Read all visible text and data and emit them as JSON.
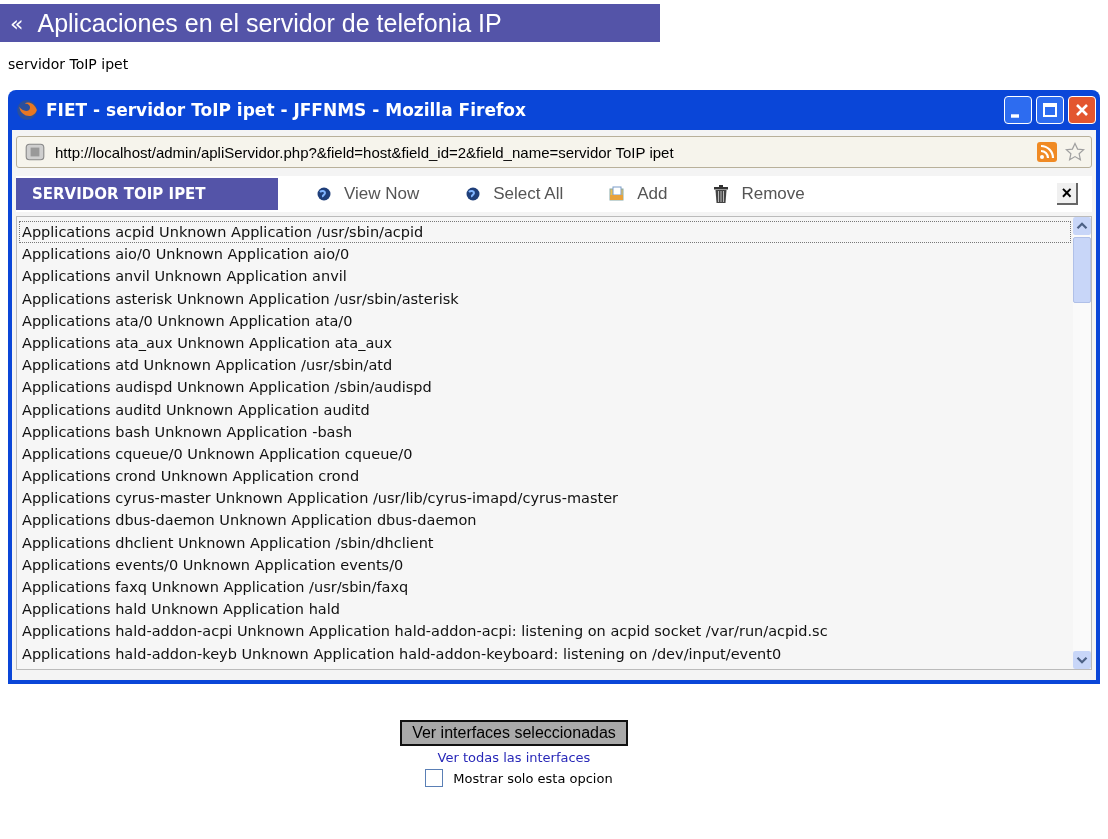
{
  "header": {
    "back": "«",
    "title": "Aplicaciones en el servidor de telefonia IP"
  },
  "subtitle": "servidor ToIP ipet",
  "window": {
    "title": "FIET - servidor ToIP ipet - JFFNMS - Mozilla Firefox",
    "url": "http://localhost/admin/apliServidor.php?&field=host&field_id=2&field_name=servidor ToIP ipet"
  },
  "toolbar": {
    "heading": "SERVIDOR TOIP IPET",
    "actions": [
      {
        "kind": "view",
        "label": "View Now"
      },
      {
        "kind": "select",
        "label": "Select All"
      },
      {
        "kind": "add",
        "label": "Add"
      },
      {
        "kind": "remove",
        "label": "Remove"
      }
    ],
    "close": "×"
  },
  "list": [
    {
      "text": "Applications acpid Unknown Application /usr/sbin/acpid",
      "selected": true
    },
    {
      "text": "Applications aio/0 Unknown Application aio/0",
      "selected": false
    },
    {
      "text": "Applications anvil Unknown Application anvil",
      "selected": false
    },
    {
      "text": "Applications asterisk Unknown Application /usr/sbin/asterisk",
      "selected": false
    },
    {
      "text": "Applications ata/0 Unknown Application ata/0",
      "selected": false
    },
    {
      "text": "Applications ata_aux Unknown Application ata_aux",
      "selected": false
    },
    {
      "text": "Applications atd Unknown Application /usr/sbin/atd",
      "selected": false
    },
    {
      "text": "Applications audispd Unknown Application /sbin/audispd",
      "selected": false
    },
    {
      "text": "Applications auditd Unknown Application auditd",
      "selected": false
    },
    {
      "text": "Applications bash Unknown Application -bash",
      "selected": false
    },
    {
      "text": "Applications cqueue/0 Unknown Application cqueue/0",
      "selected": false
    },
    {
      "text": "Applications crond Unknown Application crond",
      "selected": false
    },
    {
      "text": "Applications cyrus-master Unknown Application /usr/lib/cyrus-imapd/cyrus-master",
      "selected": false
    },
    {
      "text": "Applications dbus-daemon Unknown Application dbus-daemon",
      "selected": false
    },
    {
      "text": "Applications dhclient Unknown Application /sbin/dhclient",
      "selected": false
    },
    {
      "text": "Applications events/0 Unknown Application events/0",
      "selected": false
    },
    {
      "text": "Applications faxq Unknown Application /usr/sbin/faxq",
      "selected": false
    },
    {
      "text": "Applications hald Unknown Application hald",
      "selected": false
    },
    {
      "text": "Applications hald-addon-acpi Unknown Application hald-addon-acpi: listening on acpid socket /var/run/acpid.sc",
      "selected": false
    },
    {
      "text": "Applications hald-addon-keyb Unknown Application hald-addon-keyboard: listening on /dev/input/event0",
      "selected": false
    }
  ],
  "bottom": {
    "button": "Ver interfaces seleccionadas",
    "link": "Ver todas las interfaces",
    "checkbox": {
      "label": "Mostrar solo esta opcion",
      "checked": false
    }
  }
}
